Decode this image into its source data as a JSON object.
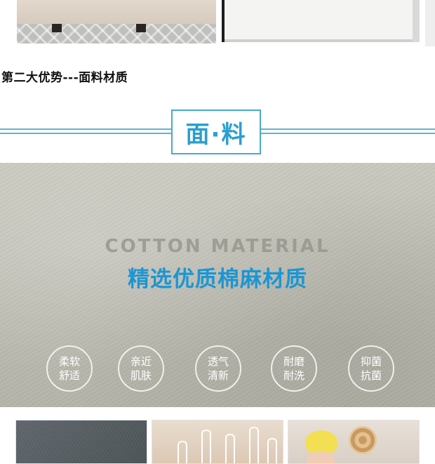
{
  "section": {
    "heading": "第二大优势---面料材质"
  },
  "banner": {
    "title": "面·料",
    "accent_color": "#2c9fd0"
  },
  "fabric": {
    "caption": "COTTON MATERIAL",
    "slogan": "精选优质棉麻材质",
    "features": [
      {
        "line1": "柔软",
        "line2": "舒适"
      },
      {
        "line1": "亲近",
        "line2": "肌肤"
      },
      {
        "line1": "透气",
        "line2": "清新"
      },
      {
        "line1": "耐磨",
        "line2": "耐洗"
      },
      {
        "line1": "抑菌",
        "line2": "抗菌"
      }
    ]
  }
}
